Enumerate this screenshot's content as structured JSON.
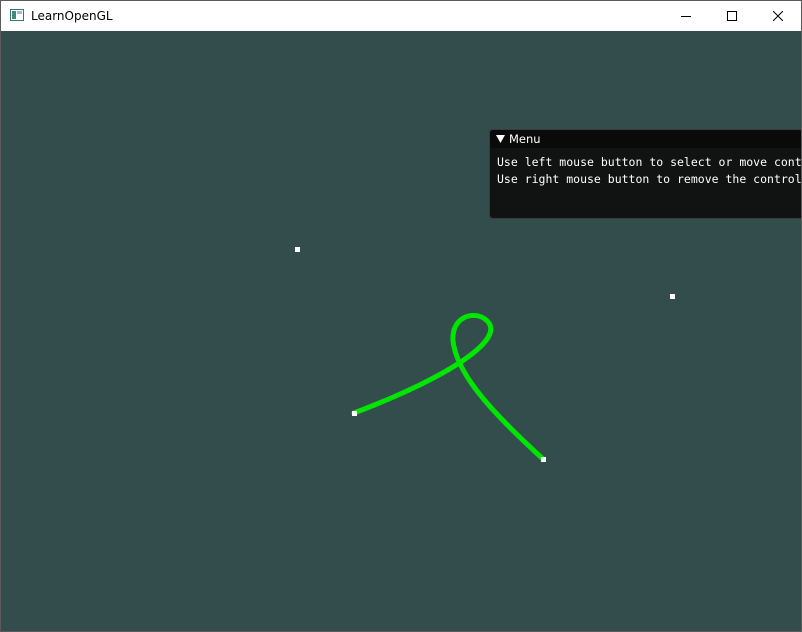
{
  "window": {
    "title": "LearnOpenGL",
    "controls": [
      "minimize-icon",
      "maximize-icon",
      "close-icon"
    ]
  },
  "scene": {
    "background_color": "#334d4d",
    "curve_color": "#00e600",
    "control_point_color": "#ffffff"
  },
  "menu": {
    "title": "Menu",
    "collapse_icon": "collapse-arrow-icon",
    "lines": [
      "Use left mouse button to select or move control points.",
      "Use right mouse button to remove the control points."
    ]
  }
}
